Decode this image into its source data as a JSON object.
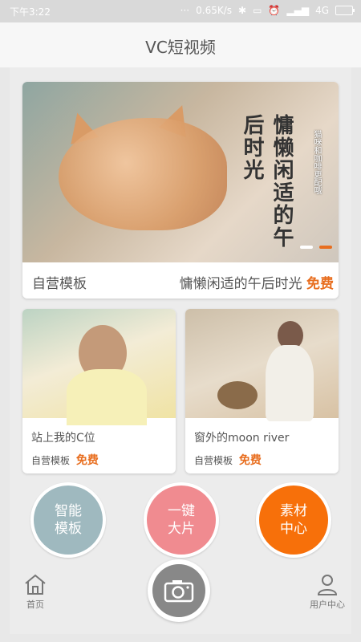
{
  "status": {
    "time": "下午3:22",
    "speed": "0.65K/s",
    "network": "4G"
  },
  "appbar": {
    "title": "VC短视频"
  },
  "hero": {
    "image_text": "慵懒闲适的午后时光",
    "image_subtext": "猫咪和咖啡更配哦",
    "left_label": "自营模板",
    "right_label": "慵懒闲适的午后时光",
    "price": "免费"
  },
  "cards": [
    {
      "title": "站上我的C位",
      "meta": "自营模板",
      "price": "免费"
    },
    {
      "title": "窗外的moon river",
      "meta": "自营模板",
      "price": "免费"
    }
  ],
  "actions": [
    {
      "line1": "智能",
      "line2": "模板",
      "color": "#9fb9bf"
    },
    {
      "line1": "一键",
      "line2": "大片",
      "color": "#f08b90"
    },
    {
      "line1": "素材",
      "line2": "中心",
      "color": "#f7700a"
    }
  ],
  "nav": {
    "home": "首页",
    "user": "用户中心"
  }
}
